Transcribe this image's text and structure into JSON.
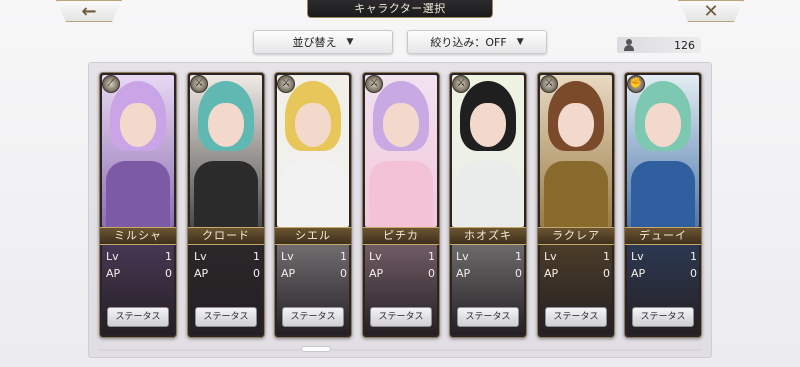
{
  "header": {
    "title": "キャラクター選択"
  },
  "nav": {
    "back_glyph": "←",
    "close_glyph": "✕"
  },
  "controls": {
    "sort_label": "並び替え",
    "filter_label": "絞り込み：OFF",
    "dropdown_glyph": "▼",
    "owned_count": "126"
  },
  "stat_labels": {
    "lv": "Lv",
    "ap": "AP"
  },
  "status_button_label": "ステータス",
  "characters": [
    {
      "name": "ミルシャ",
      "lv": "1",
      "ap": "0",
      "badge_icon": "staff-icon",
      "badge_glyph": "⟋",
      "hair": "#c9a4e6",
      "body": "#7c5aa6",
      "bg": "#e7d8f2"
    },
    {
      "name": "クロード",
      "lv": "1",
      "ap": "0",
      "badge_icon": "sword-icon",
      "badge_glyph": "⚔",
      "hair": "#5fb9b2",
      "body": "#2b2b2b",
      "bg": "#efeae4"
    },
    {
      "name": "シエル",
      "lv": "1",
      "ap": "0",
      "badge_icon": "sword-icon",
      "badge_glyph": "⚔",
      "hair": "#e8c75a",
      "body": "#f2f2f2",
      "bg": "#f2efe8"
    },
    {
      "name": "ピチカ",
      "lv": "1",
      "ap": "0",
      "badge_icon": "sword-icon",
      "badge_glyph": "⚔",
      "hair": "#c8a9e4",
      "body": "#f3c2d6",
      "bg": "#f1e2ef"
    },
    {
      "name": "ホオズキ",
      "lv": "1",
      "ap": "0",
      "badge_icon": "sword-icon",
      "badge_glyph": "⚔",
      "hair": "#1f1f1f",
      "body": "#e9ecea",
      "bg": "#eef3e2"
    },
    {
      "name": "ラクレア",
      "lv": "1",
      "ap": "0",
      "badge_icon": "sword-icon",
      "badge_glyph": "⚔",
      "hair": "#7a4a2a",
      "body": "#8a6a2c",
      "bg": "#e8d9c2"
    },
    {
      "name": "デューイ",
      "lv": "1",
      "ap": "0",
      "badge_icon": "gauntlet-icon",
      "badge_glyph": "✊",
      "hair": "#7cc8b0",
      "body": "#2f5f9e",
      "bg": "#e3edf2"
    }
  ]
}
